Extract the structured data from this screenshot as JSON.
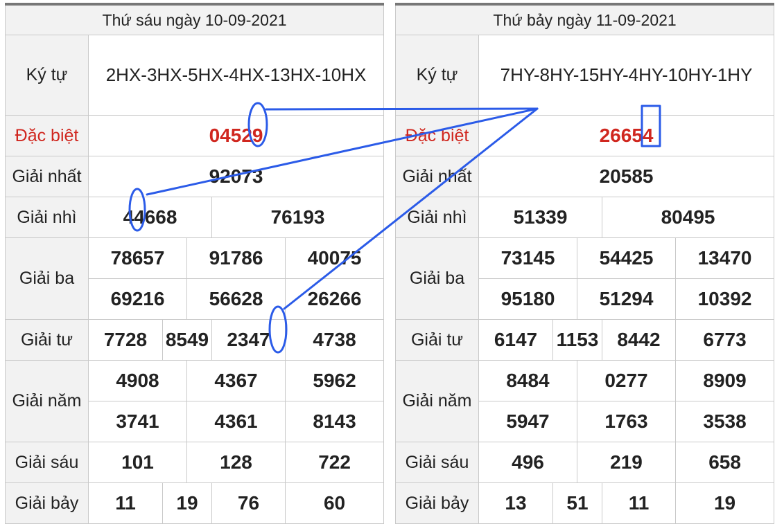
{
  "left": {
    "title": "Thứ sáu ngày 10-09-2021",
    "labels": {
      "ky_tu": "Ký tự",
      "dac_biet": "Đặc biệt",
      "giai_nhat": "Giải nhất",
      "giai_nhi": "Giải nhì",
      "giai_ba": "Giải ba",
      "giai_tu": "Giải tư",
      "giai_nam": "Giải năm",
      "giai_sau": "Giải sáu",
      "giai_bay": "Giải bảy"
    },
    "ky_tu": "2HX-3HX-5HX-4HX-13HX-10HX",
    "dac_biet": "04529",
    "giai_nhat": "92073",
    "giai_nhi": [
      "44668",
      "76193"
    ],
    "giai_ba": [
      "78657",
      "91786",
      "40075",
      "69216",
      "56628",
      "26266"
    ],
    "giai_tu": [
      "7728",
      "8549",
      "2347",
      "4738"
    ],
    "giai_nam": [
      "4908",
      "4367",
      "5962",
      "3741",
      "4361",
      "8143"
    ],
    "giai_sau": [
      "101",
      "128",
      "722"
    ],
    "giai_bay": [
      "11",
      "19",
      "76",
      "60"
    ]
  },
  "right": {
    "title": "Thứ bảy ngày 11-09-2021",
    "labels": {
      "ky_tu": "Ký tự",
      "dac_biet": "Đặc biệt",
      "giai_nhat": "Giải nhất",
      "giai_nhi": "Giải nhì",
      "giai_ba": "Giải ba",
      "giai_tu": "Giải tư",
      "giai_nam": "Giải năm",
      "giai_sau": "Giải sáu",
      "giai_bay": "Giải bảy"
    },
    "ky_tu": "7HY-8HY-15HY-4HY-10HY-1HY",
    "dac_biet": "26654",
    "giai_nhat": "20585",
    "giai_nhi": [
      "51339",
      "80495"
    ],
    "giai_ba": [
      "73145",
      "54425",
      "13470",
      "95180",
      "51294",
      "10392"
    ],
    "giai_tu": [
      "6147",
      "1153",
      "8442",
      "6773"
    ],
    "giai_nam": [
      "8484",
      "0277",
      "8909",
      "5947",
      "1763",
      "3538"
    ],
    "giai_sau": [
      "496",
      "219",
      "658"
    ],
    "giai_bay": [
      "13",
      "51",
      "11",
      "19"
    ]
  },
  "colors": {
    "special": "#d0271f",
    "annotation": "#2b5be8"
  }
}
